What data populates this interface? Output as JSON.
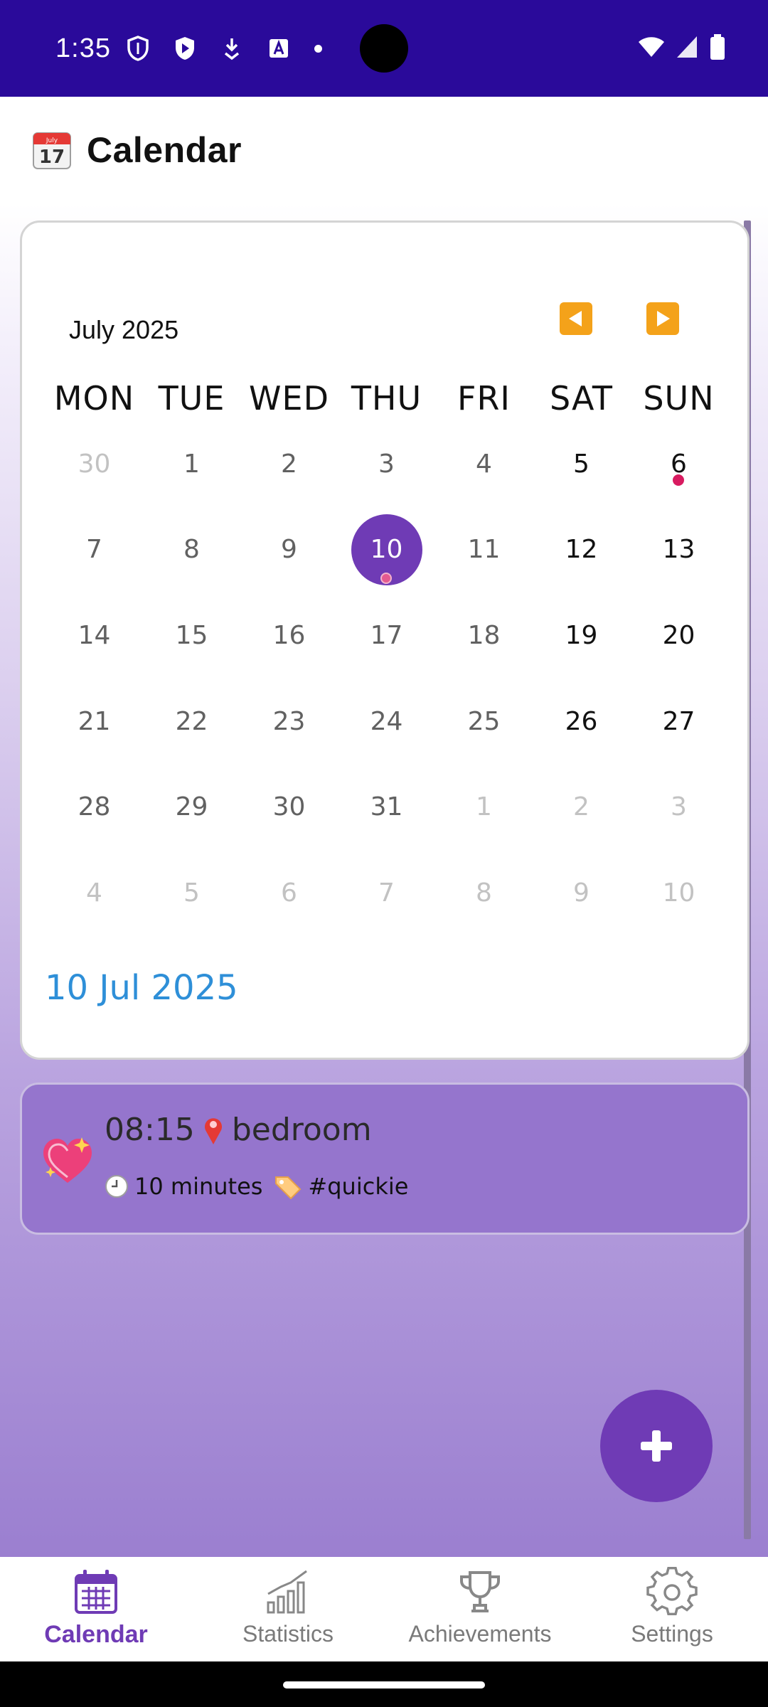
{
  "status": {
    "time": "1:35"
  },
  "appbar": {
    "title": "Calendar",
    "icon": "calendar-17-icon"
  },
  "calendar": {
    "month_label": "July 2025",
    "prev_icon": "triangle-left-icon",
    "next_icon": "triangle-right-icon",
    "weekdays": [
      "MON",
      "TUE",
      "WED",
      "THU",
      "FRI",
      "SAT",
      "SUN"
    ],
    "weeks": [
      [
        "30",
        "1",
        "2",
        "3",
        "4",
        "5",
        "6"
      ],
      [
        "7",
        "8",
        "9",
        "10",
        "11",
        "12",
        "13"
      ],
      [
        "14",
        "15",
        "16",
        "17",
        "18",
        "19",
        "20"
      ],
      [
        "21",
        "22",
        "23",
        "24",
        "25",
        "26",
        "27"
      ],
      [
        "28",
        "29",
        "30",
        "31",
        "1",
        "2",
        "3"
      ],
      [
        "4",
        "5",
        "6",
        "7",
        "8",
        "9",
        "10"
      ]
    ],
    "selected_day": "10",
    "event_days": [
      "6",
      "10"
    ],
    "selected_color": "#6f3bb5",
    "event_dot_color": "#d81b60",
    "selected_date_label": "10 Jul 2025"
  },
  "entry": {
    "icon": "sparkling-heart-icon",
    "time": "08:15",
    "location_icon": "pin-icon",
    "location": "bedroom",
    "duration_icon": "clock-icon",
    "duration": "10 minutes",
    "tag_icon": "tag-icon",
    "tag": "#quickie",
    "card_color": "#9575cd"
  },
  "fab": {
    "icon": "plus-icon"
  },
  "bottom_nav": {
    "items": [
      {
        "label": "Calendar",
        "icon": "calendar-icon",
        "active": true
      },
      {
        "label": "Statistics",
        "icon": "bar-chart-icon",
        "active": false
      },
      {
        "label": "Achievements",
        "icon": "trophy-icon",
        "active": false
      },
      {
        "label": "Settings",
        "icon": "gear-icon",
        "active": false
      }
    ],
    "active_color": "#6f3bb5"
  }
}
